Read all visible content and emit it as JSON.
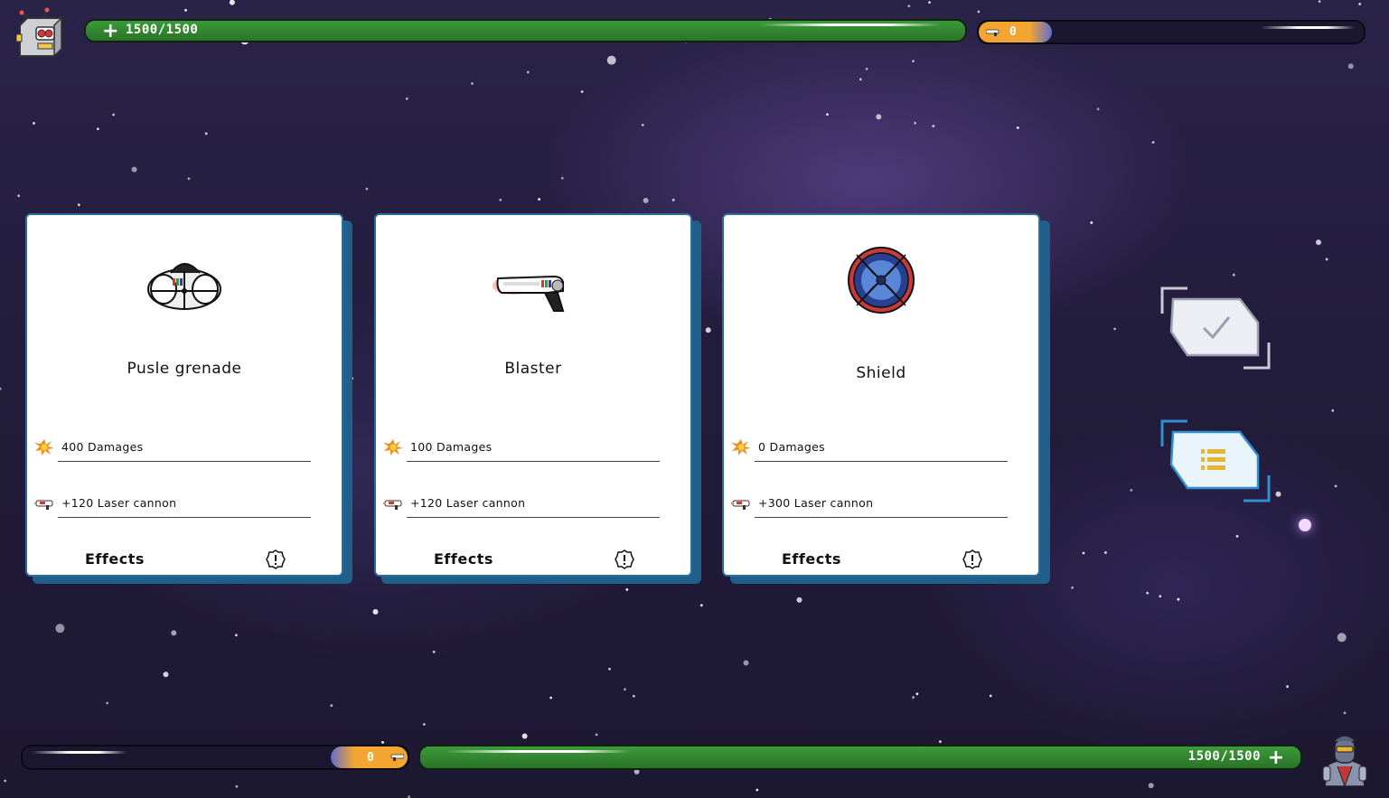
{
  "player_top": {
    "hp_text": "1500/1500",
    "hp_fraction": 1.0,
    "energy_value": "0",
    "energy_fraction": 0.19,
    "avatar": "robot-icon"
  },
  "player_bottom": {
    "hp_text": "1500/1500",
    "hp_fraction": 1.0,
    "energy_value": "0",
    "energy_fraction": 0.2,
    "avatar": "armored-pilot-icon"
  },
  "cards": [
    {
      "title": "Pusle grenade",
      "icon": "grenade-icon",
      "damage_text": "400 Damages",
      "weapon_text": "+120 Laser cannon",
      "effects_label": "Effects"
    },
    {
      "title": "Blaster",
      "icon": "blaster-icon",
      "damage_text": "100 Damages",
      "weapon_text": "+120 Laser cannon",
      "effects_label": "Effects"
    },
    {
      "title": "Shield",
      "icon": "shield-icon",
      "damage_text": "0 Damages",
      "weapon_text": "+300 Laser cannon",
      "effects_label": "Effects"
    }
  ],
  "side_buttons": {
    "confirm_icon": "checkmark-icon",
    "list_icon": "list-icon"
  },
  "colors": {
    "hp_green": "#2f7a2d",
    "energy_orange": "#f2a531",
    "card_border": "#2a6ea0",
    "space_bg": "#241e40"
  }
}
